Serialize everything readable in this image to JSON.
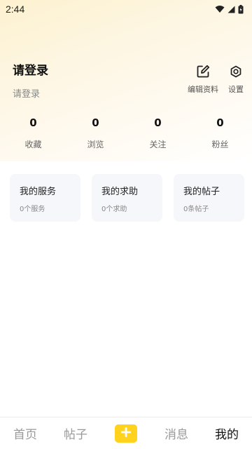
{
  "status_bar": {
    "time": "2:44",
    "icons": [
      "wifi-icon",
      "signal-icon",
      "battery-icon"
    ]
  },
  "profile": {
    "name": "请登录",
    "subtitle": "请登录"
  },
  "header_actions": [
    {
      "label": "编辑资料",
      "icon": "edit-icon"
    },
    {
      "label": "设置",
      "icon": "gear-icon"
    }
  ],
  "stats": [
    {
      "value": "0",
      "label": "收藏"
    },
    {
      "value": "0",
      "label": "浏览"
    },
    {
      "value": "0",
      "label": "关注"
    },
    {
      "value": "0",
      "label": "粉丝"
    }
  ],
  "cards": [
    {
      "title": "我的服务",
      "subtitle": "0个服务"
    },
    {
      "title": "我的求助",
      "subtitle": "0个求助"
    },
    {
      "title": "我的帖子",
      "subtitle": "0条帖子"
    }
  ],
  "bottom_nav": {
    "items": [
      {
        "label": "首页",
        "active": false
      },
      {
        "label": "帖子",
        "active": false
      },
      {
        "label": "",
        "icon": "plus-icon",
        "active": false
      },
      {
        "label": "消息",
        "active": false
      },
      {
        "label": "我的",
        "active": true
      }
    ],
    "accent_color": "#ffd21e"
  },
  "colors": {
    "hero_gradient_start": "#fdf1cf",
    "card_background": "#f6f7fa",
    "accent": "#ffd21e"
  }
}
